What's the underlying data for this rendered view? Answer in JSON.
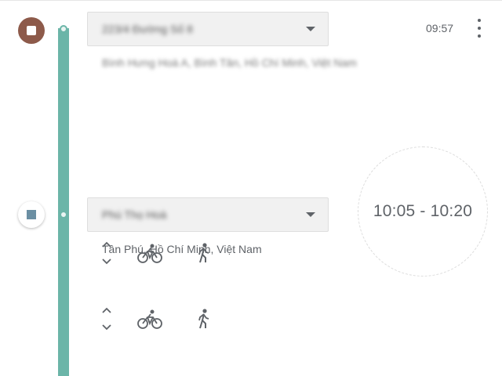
{
  "stops": [
    {
      "place_name": "223/4 Đường Số 8",
      "address": "Bình Hưng Hoà A, Bình Tân, Hồ Chí Minh, Việt Nam",
      "time": "09:57",
      "marker": "stop-marker-start"
    },
    {
      "place_name": "Phú Thọ Hoà",
      "address": "Tân Phú, Hồ Chí Minh, Việt Nam",
      "time_range": "10:05 - 10:20",
      "marker": "stop-marker-end"
    }
  ],
  "icons": {
    "more": "more-vert-icon",
    "caret": "dropdown-caret-icon",
    "reorder": "reorder-chevrons-icon",
    "bike": "bicycle-icon",
    "walk": "walking-icon"
  },
  "colors": {
    "timeline": "#6bb5a8",
    "start_marker": "#8d5a4a",
    "end_marker_square": "#6b8fa3"
  }
}
